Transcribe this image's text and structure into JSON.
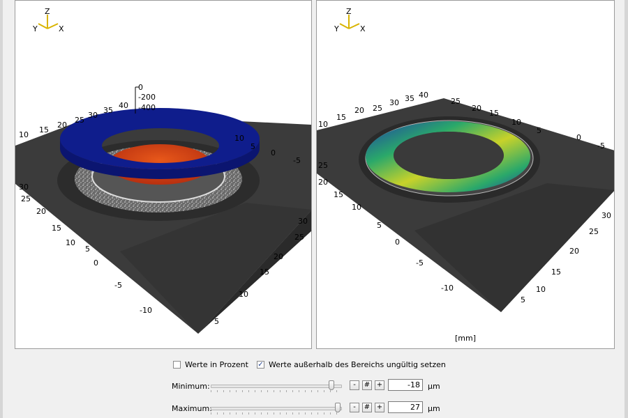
{
  "left_view": {
    "triad": {
      "z": "Z",
      "y": "Y",
      "x": "X"
    },
    "z_ticks": [
      "0",
      "-200",
      "-400"
    ],
    "back_left_ticks": [
      "10",
      "15",
      "20",
      "25",
      "30",
      "35",
      "40"
    ],
    "back_right_ticks": [
      "10",
      "5",
      "0",
      "-5"
    ],
    "front_left_ticks": [
      "30",
      "25",
      "20",
      "15",
      "10",
      "5",
      "0",
      "-5",
      "-10"
    ],
    "front_right_ticks": [
      "30",
      "25",
      "20",
      "15",
      "10",
      "5"
    ]
  },
  "right_view": {
    "triad": {
      "z": "Z",
      "y": "Y",
      "x": "X"
    },
    "back_left_ticks": [
      "10",
      "15",
      "20",
      "25",
      "30",
      "35",
      "40"
    ],
    "back_right_ticks": [
      "25",
      "20",
      "15",
      "10",
      "5",
      "0",
      "-5"
    ],
    "front_left_ticks": [
      "25",
      "20",
      "15",
      "10",
      "5",
      "0",
      "-5",
      "-10"
    ],
    "front_right_ticks": [
      "30",
      "25",
      "20",
      "15",
      "10",
      "5"
    ],
    "unit_label": "[mm]"
  },
  "options": {
    "percent": {
      "label": "Werte in Prozent",
      "checked": false
    },
    "invalid": {
      "label": "Werte außerhalb des Bereichs ungültig setzen",
      "checked": true
    }
  },
  "minimum": {
    "label": "Minimum:",
    "value": "-18",
    "unit": "µm",
    "slider_fraction": 0.92
  },
  "maximum": {
    "label": "Maximum:",
    "value": "27",
    "unit": "µm",
    "slider_fraction": 0.97
  },
  "buttons": {
    "minus": "-",
    "hash": "#",
    "plus": "+"
  },
  "colors": {
    "ring_blue": "#0f1d8c",
    "surface_red": "#d84a14",
    "ring_scale_green": "#2aa86a",
    "ring_scale_yellow": "#c8d22a",
    "ring_scale_blue": "#1f3fa8",
    "base_dark": "#3c3c3c"
  }
}
